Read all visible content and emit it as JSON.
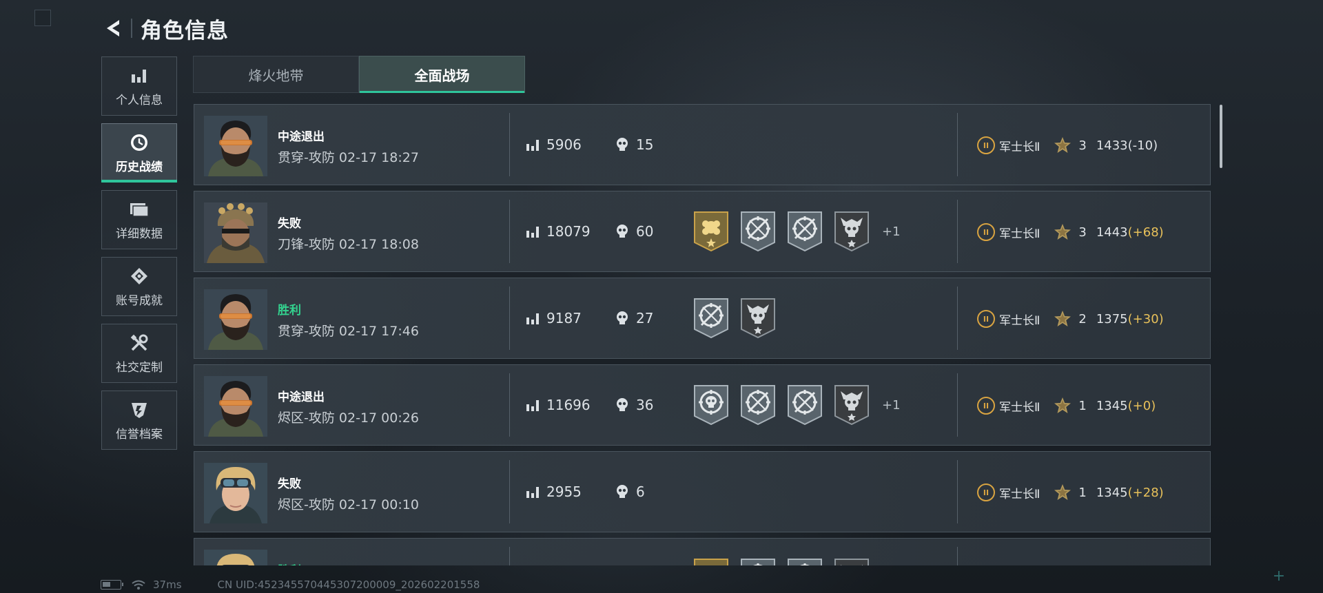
{
  "header": {
    "title": "角色信息",
    "back_icon": "back-arrow-icon"
  },
  "sidebar": {
    "items": [
      {
        "label": "个人信息",
        "icon": "bar-chart-icon",
        "active": false
      },
      {
        "label": "历史战绩",
        "icon": "clock-icon",
        "active": true
      },
      {
        "label": "详细数据",
        "icon": "folder-icon",
        "active": false
      },
      {
        "label": "账号成就",
        "icon": "achievement-icon",
        "active": false
      },
      {
        "label": "社交定制",
        "icon": "tools-icon",
        "active": false
      },
      {
        "label": "信誉档案",
        "icon": "shield-icon",
        "active": false
      }
    ]
  },
  "tabs": [
    {
      "label": "烽火地带",
      "active": false
    },
    {
      "label": "全面战场",
      "active": true
    }
  ],
  "colors": {
    "accent": "#2fc59b",
    "win": "#33d38f",
    "gold": "#d9a441",
    "delta_up": "#e8c15a"
  },
  "matches": [
    {
      "result": "中途退出",
      "outcome": "quit",
      "mode": "贯穿-攻防",
      "time": "02-17 18:27",
      "score": "5906",
      "kills": "15",
      "medals": [],
      "extra": "",
      "rank": "军士长Ⅱ",
      "rank_badge": "II",
      "stars": "3",
      "mmr": "1433",
      "delta": "(-10)",
      "avatar": "bearded-operator"
    },
    {
      "result": "失败",
      "outcome": "loss",
      "mode": "刀锋-攻防",
      "time": "02-17 18:08",
      "score": "18079",
      "kills": "60",
      "medals": [
        "gold-flower-medal",
        "crossed-rifle-medal",
        "crossed-rifle-medal",
        "skull-medal"
      ],
      "extra": "+1",
      "rank": "军士长Ⅱ",
      "rank_badge": "II",
      "stars": "3",
      "mmr": "1443",
      "delta": "(+68)",
      "avatar": "crowned-operator"
    },
    {
      "result": "胜利",
      "outcome": "win",
      "mode": "贯穿-攻防",
      "time": "02-17 17:46",
      "score": "9187",
      "kills": "27",
      "medals": [
        "crossed-rifle-medal",
        "skull-medal"
      ],
      "extra": "",
      "rank": "军士长Ⅱ",
      "rank_badge": "II",
      "stars": "2",
      "mmr": "1375",
      "delta": "(+30)",
      "avatar": "bearded-operator"
    },
    {
      "result": "中途退出",
      "outcome": "quit",
      "mode": "烬区-攻防",
      "time": "02-17 00:26",
      "score": "11696",
      "kills": "36",
      "medals": [
        "target-skull-medal",
        "crossed-rifle-medal",
        "crossed-rifle-medal",
        "skull-medal"
      ],
      "extra": "+1",
      "rank": "军士长Ⅱ",
      "rank_badge": "II",
      "stars": "1",
      "mmr": "1345",
      "delta": "(+0)",
      "avatar": "bearded-operator"
    },
    {
      "result": "失败",
      "outcome": "loss",
      "mode": "烬区-攻防",
      "time": "02-17 00:10",
      "score": "2955",
      "kills": "6",
      "medals": [],
      "extra": "",
      "rank": "军士长Ⅱ",
      "rank_badge": "II",
      "stars": "1",
      "mmr": "1345",
      "delta": "(+28)",
      "avatar": "blonde-operator"
    },
    {
      "result": "胜利",
      "outcome": "win",
      "mode": "",
      "time": "",
      "score": "",
      "kills": "",
      "medals": [
        "gold-flower-medal",
        "crossed-rifle-medal",
        "crossed-rifle-medal",
        "skull-medal"
      ],
      "extra": "",
      "rank": "",
      "rank_badge": "",
      "stars": "",
      "mmr": "",
      "delta": "",
      "avatar": "blonde-operator"
    }
  ],
  "status_bar": {
    "ping": "37ms",
    "uid": "CN UID:452345570445307200009_202602201558"
  }
}
